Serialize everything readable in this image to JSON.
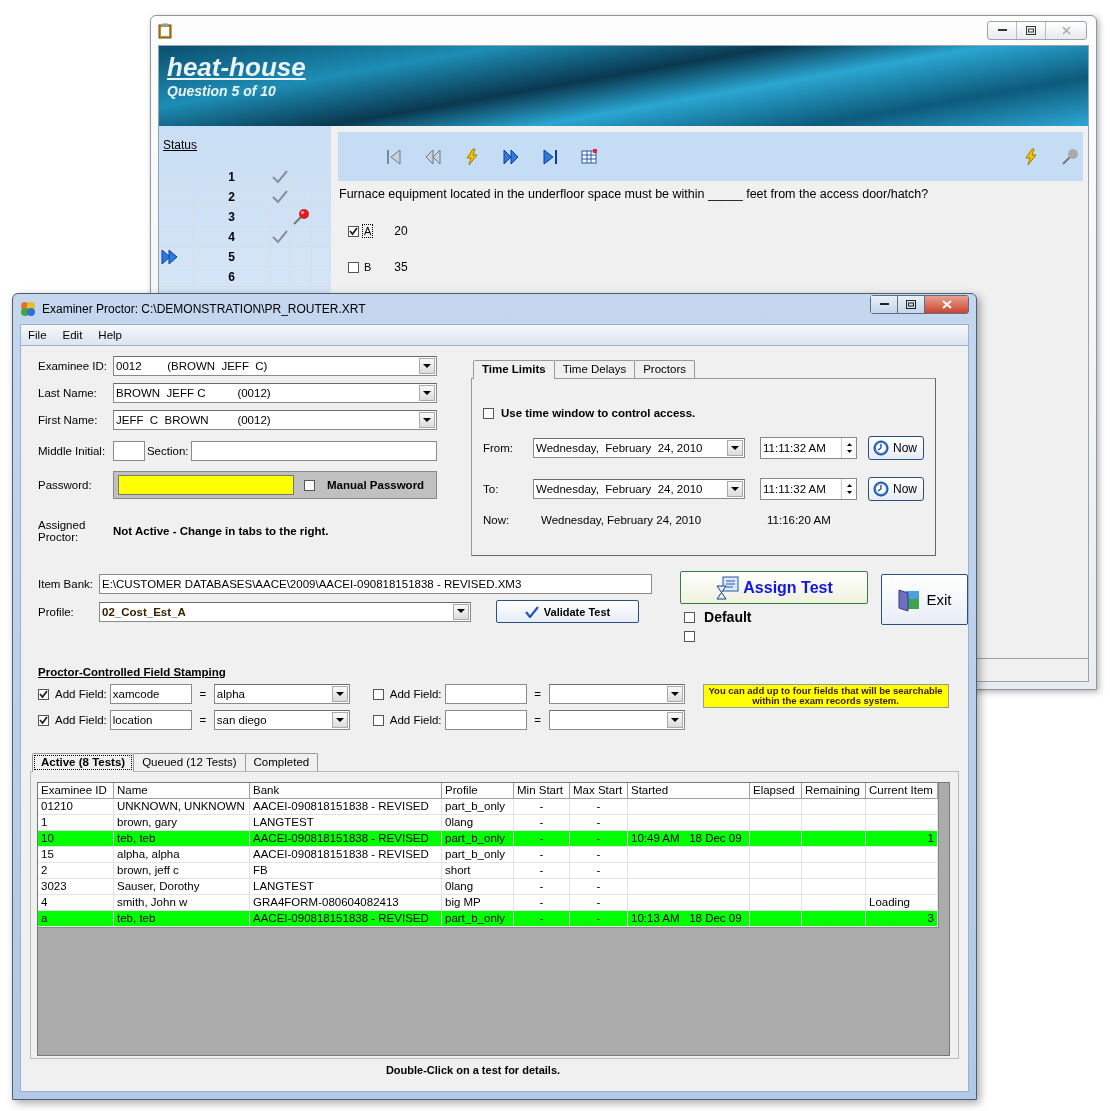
{
  "exam_window": {
    "banner": {
      "title": "heat-house",
      "subtitle": "Question 5 of 10"
    },
    "status_link": "Status",
    "question_list": [
      {
        "number": "1",
        "kind": "check",
        "current": false
      },
      {
        "number": "2",
        "kind": "check",
        "current": false
      },
      {
        "number": "3",
        "kind": "pin",
        "current": false
      },
      {
        "number": "4",
        "kind": "check",
        "current": false
      },
      {
        "number": "5",
        "kind": "none",
        "current": true
      },
      {
        "number": "6",
        "kind": "none",
        "current": false
      }
    ],
    "question_text": "Furnace equipment located in the underfloor space must be within _____ feet from the access door/hatch?",
    "answers": [
      {
        "letter": "A",
        "text": "20",
        "checked": true
      },
      {
        "letter": "B",
        "text": "35",
        "checked": false
      }
    ]
  },
  "proctor_window": {
    "title": "Examiner Proctor: C:\\DEMONSTRATION\\PR_ROUTER.XRT",
    "menu": [
      "File",
      "Edit",
      "Help"
    ],
    "examinee_id": {
      "label": "Examinee ID:",
      "value": "0012        (BROWN  JEFF  C)"
    },
    "last_name": {
      "label": "Last Name:",
      "value": "BROWN  JEFF C          (0012)"
    },
    "first_name": {
      "label": "First Name:",
      "value": "JEFF  C  BROWN         (0012)"
    },
    "middle_initial": {
      "label": "Middle Initial:"
    },
    "section": {
      "label": "Section:"
    },
    "password": {
      "label": "Password:",
      "manual_password": {
        "label": "Manual Password",
        "checked": false
      }
    },
    "assigned_proctor": {
      "label": "Assigned Proctor:",
      "value": "Not Active - Change in tabs to the right."
    },
    "time_tabs": [
      {
        "label": "Time Limits",
        "selected": true
      },
      {
        "label": "Time Delays",
        "selected": false
      },
      {
        "label": "Proctors",
        "selected": false
      }
    ],
    "use_time_window": {
      "label": "Use time window to control access.",
      "checked": false
    },
    "from": {
      "label": "From:",
      "date": "Wednesday,  February  24, 2010",
      "time": "11:11:32 AM",
      "button": "Now"
    },
    "to": {
      "label": "To:",
      "date": "Wednesday,  February  24, 2010",
      "time": "11:11:32 AM",
      "button": "Now"
    },
    "now": {
      "label": "Now:",
      "date": "Wednesday, February 24, 2010",
      "time": "11:16:20 AM"
    },
    "item_bank": {
      "label": "Item Bank:",
      "value": "E:\\CUSTOMER DATABASES\\AACE\\2009\\AACEI-090818151838 - REVISED.XM3"
    },
    "profile": {
      "label": "Profile:",
      "value": "02_Cost_Est_A"
    },
    "validate_button": "Validate Test",
    "assign_button": "Assign Test",
    "default_checkbox": {
      "label": "Default",
      "checked": false
    },
    "extra_checkbox": {
      "checked": false
    },
    "exit_button": "Exit",
    "stamping": {
      "heading": "Proctor-Controlled Field Stamping",
      "fields": [
        {
          "label": "Add Field:",
          "checked": true,
          "name": "xamcode",
          "equals": "=",
          "value": "alpha"
        },
        {
          "label": "Add Field:",
          "checked": false,
          "equals": "="
        },
        {
          "label": "Add Field:",
          "checked": true,
          "name": "location",
          "equals": "=",
          "value": "san diego"
        },
        {
          "label": "Add Field:",
          "checked": false,
          "equals": "="
        }
      ],
      "note": "You can add up to four fields that will be searchable within the exam records system."
    },
    "test_tabs": [
      {
        "label": "Active (8 Tests)",
        "selected": true
      },
      {
        "label": "Queued (12 Tests)",
        "selected": false
      },
      {
        "label": "Completed",
        "selected": false
      }
    ],
    "table": {
      "columns": [
        "Examinee ID",
        "Name",
        "Bank",
        "Profile",
        "Min Start",
        "Max Start",
        "Started",
        "Elapsed",
        "Remaining",
        "Current Item"
      ],
      "rows": [
        {
          "examinee_id": "01210",
          "name": "UNKNOWN, UNKNOWN",
          "bank": "AACEI-090818151838 - REVISED",
          "profile": "part_b_only",
          "min_start": "-",
          "max_start": "-",
          "highlighted": false
        },
        {
          "examinee_id": "1",
          "name": "brown, gary",
          "bank": "LANGTEST",
          "profile": "0lang",
          "min_start": "-",
          "max_start": "-",
          "highlighted": false
        },
        {
          "examinee_id": "10",
          "name": "teb, teb",
          "bank": "AACEI-090818151838 - REVISED",
          "profile": "part_b_only",
          "min_start": "-",
          "max_start": "-",
          "started": "10:49 AM   18 Dec 09",
          "current_item": "1",
          "highlighted": true
        },
        {
          "examinee_id": "15",
          "name": "alpha, alpha",
          "bank": "AACEI-090818151838 - REVISED",
          "profile": "part_b_only",
          "min_start": "-",
          "max_start": "-",
          "highlighted": false
        },
        {
          "examinee_id": "2",
          "name": "brown, jeff c",
          "bank": "FB",
          "profile": "short",
          "min_start": "-",
          "max_start": "-",
          "highlighted": false
        },
        {
          "examinee_id": "3023",
          "name": "Sauser, Dorothy",
          "bank": "LANGTEST",
          "profile": "0lang",
          "min_start": "-",
          "max_start": "-",
          "highlighted": false
        },
        {
          "examinee_id": "4",
          "name": "smith, John w",
          "bank": "GRA4FORM-080604082413",
          "profile": "big MP",
          "min_start": "-",
          "max_start": "-",
          "current_item": "Loading",
          "highlighted": false
        },
        {
          "examinee_id": "a",
          "name": "teb, teb",
          "bank": "AACEI-090818151838 - REVISED",
          "profile": "part_b_only",
          "min_start": "-",
          "max_start": "-",
          "started": "10:13 AM   18 Dec 09",
          "current_item": "3",
          "highlighted": true
        }
      ]
    },
    "footer": "Double-Click on a test for details."
  }
}
